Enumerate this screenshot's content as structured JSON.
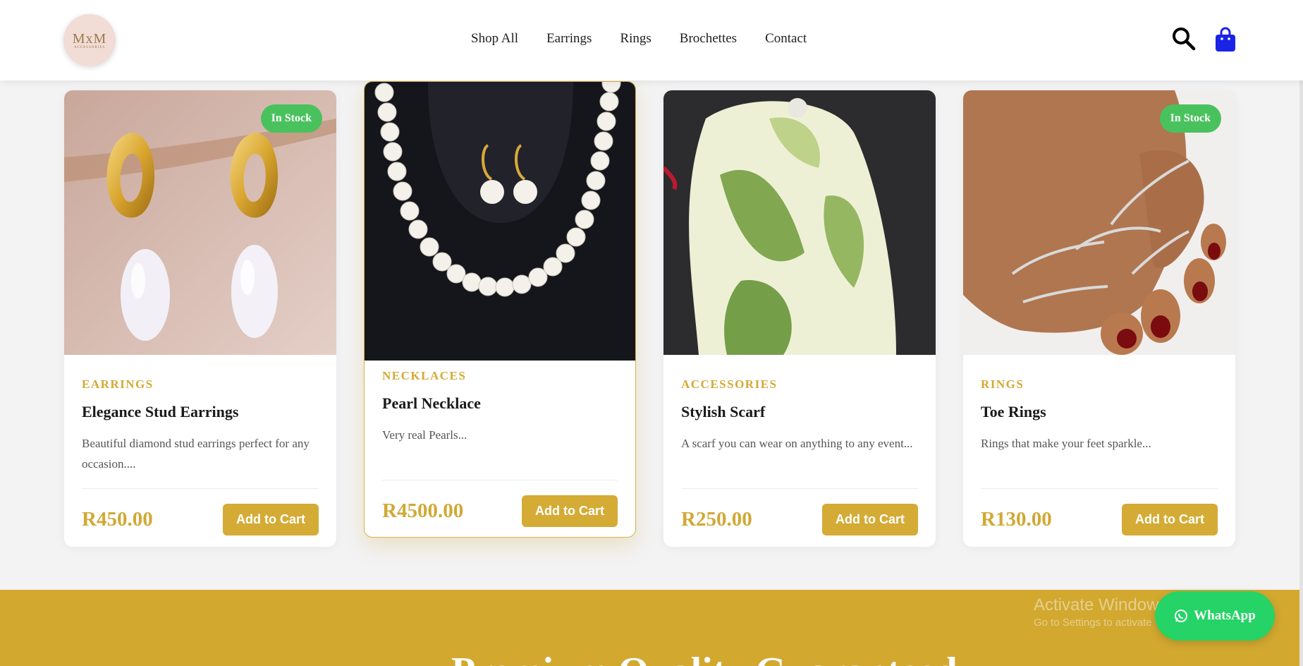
{
  "header": {
    "logo_text": "MxM",
    "logo_sub": "ACCESSORIES",
    "nav": [
      "Shop All",
      "Earrings",
      "Rings",
      "Brochettes",
      "Contact"
    ],
    "search_icon": "search-icon",
    "cart_icon": "shopping-bag-icon"
  },
  "products": [
    {
      "category": "EARRINGS",
      "name": "Elegance Stud Earrings",
      "description": "Beautiful diamond stud earrings perfect for any occasion....",
      "price": "R450.00",
      "button": "Add to Cart",
      "badge": "In Stock"
    },
    {
      "category": "NECKLACES",
      "name": "Pearl Necklace",
      "description": "Very real Pearls...",
      "price": "R4500.00",
      "button": "Add to Cart",
      "badge": ""
    },
    {
      "category": "ACCESSORIES",
      "name": "Stylish Scarf",
      "description": "A scarf you can wear on anything to any event...",
      "price": "R250.00",
      "button": "Add to Cart",
      "badge": ""
    },
    {
      "category": "RINGS",
      "name": "Toe Rings",
      "description": "Rings that make your feet sparkle...",
      "price": "R130.00",
      "button": "Add to Cart",
      "badge": "In Stock"
    }
  ],
  "section": {
    "title": "Premium Quality Guaranteed"
  },
  "whatsapp": {
    "label": "WhatsApp"
  },
  "os_watermark": {
    "line1": "Activate Windows",
    "line2": "Go to Settings to activate Windows."
  },
  "colors": {
    "gold": "#d4ab35",
    "badge_green": "#49c25d",
    "whatsapp_green": "#25d366",
    "cart_blue": "#1a23e6"
  }
}
